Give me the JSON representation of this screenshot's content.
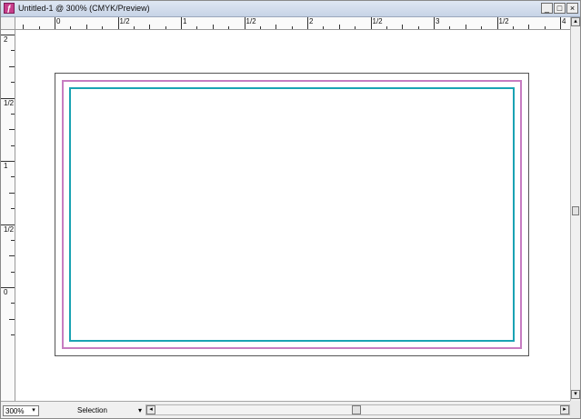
{
  "window": {
    "title": "Untitled-1 @ 300% (CMYK/Preview)",
    "app_icon_glyph": "ƒ",
    "controls": {
      "minimize": "_",
      "maximize": "□",
      "close": "×"
    }
  },
  "ruler_horizontal": {
    "labels": [
      "0",
      "1/2",
      "1",
      "1/2",
      "2",
      "1/2",
      "3",
      "1/2",
      "4"
    ]
  },
  "ruler_vertical": {
    "labels": [
      "2",
      "1/2",
      "1",
      "1/2",
      "0"
    ]
  },
  "canvas": {
    "colors": {
      "trim": "#555555",
      "bleed_guide": "#c77cc1",
      "safe_guide": "#1aa3b3"
    }
  },
  "status": {
    "zoom": "300%",
    "tool": "Selection"
  },
  "icons": {
    "dropdown": "▾",
    "scroll_up": "▴",
    "scroll_down": "▾",
    "scroll_left": "◂",
    "scroll_right": "▸"
  }
}
